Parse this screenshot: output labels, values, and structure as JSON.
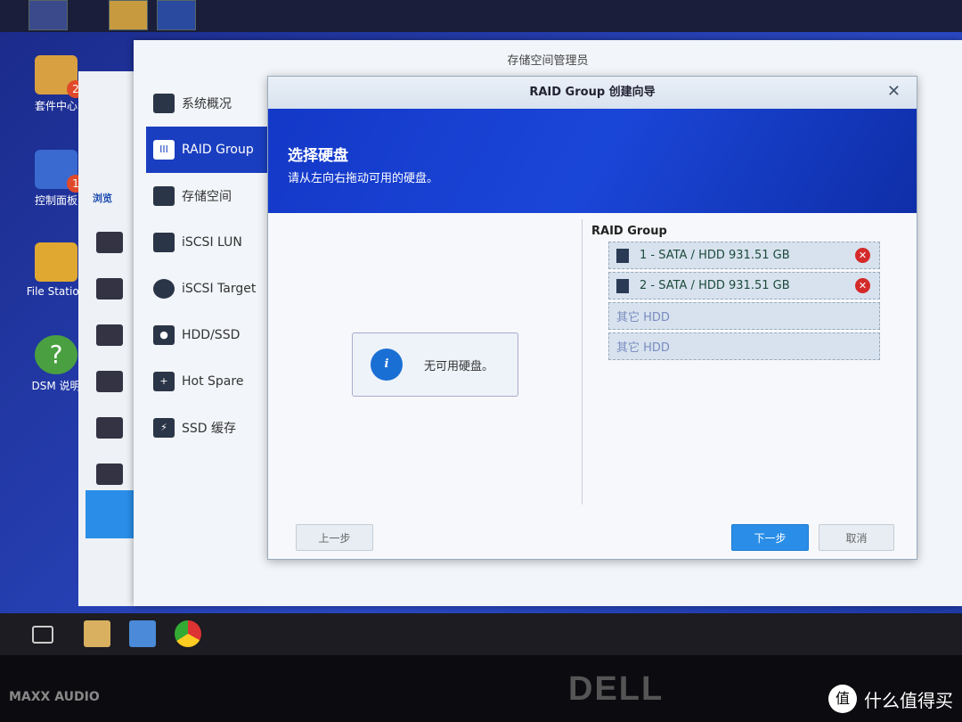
{
  "desktop": {
    "icons": [
      {
        "label": "套件中心",
        "badge": "2"
      },
      {
        "label": "控制面板",
        "badge": "1"
      },
      {
        "label": "File Station"
      },
      {
        "label": "DSM 说明"
      }
    ]
  },
  "back_window": {
    "section": "浏览"
  },
  "storage_manager": {
    "title": "存储空间管理员",
    "sidebar": [
      {
        "label": "系统概况",
        "icon": "overview-icon"
      },
      {
        "label": "RAID Group",
        "icon": "raid-icon",
        "selected": true
      },
      {
        "label": "存储空间",
        "icon": "cubes-icon"
      },
      {
        "label": "iSCSI LUN",
        "icon": "database-icon"
      },
      {
        "label": "iSCSI Target",
        "icon": "globe-icon"
      },
      {
        "label": "HDD/SSD",
        "icon": "disk-icon"
      },
      {
        "label": "Hot Spare",
        "icon": "plus-disk-icon"
      },
      {
        "label": "SSD 缓存",
        "icon": "bolt-disk-icon"
      }
    ]
  },
  "wizard": {
    "title": "RAID Group 创建向导",
    "heading": "选择硬盘",
    "subheading": "请从左向右拖动可用的硬盘。",
    "left_message": "无可用硬盘。",
    "right_title": "RAID Group",
    "slots": [
      {
        "label": "1 - SATA / HDD 931.51 GB",
        "filled": true
      },
      {
        "label": "2 - SATA / HDD 931.51 GB",
        "filled": true
      },
      {
        "label": "其它 HDD",
        "filled": false
      },
      {
        "label": "其它 HDD",
        "filled": false
      }
    ],
    "buttons": {
      "prev": "上一步",
      "next": "下一步",
      "cancel": "取消"
    },
    "accent": "#1a3ec0"
  },
  "bezel": {
    "audio": "MAXX AUDIO",
    "brand": "DELL"
  },
  "watermark": "什么值得买"
}
